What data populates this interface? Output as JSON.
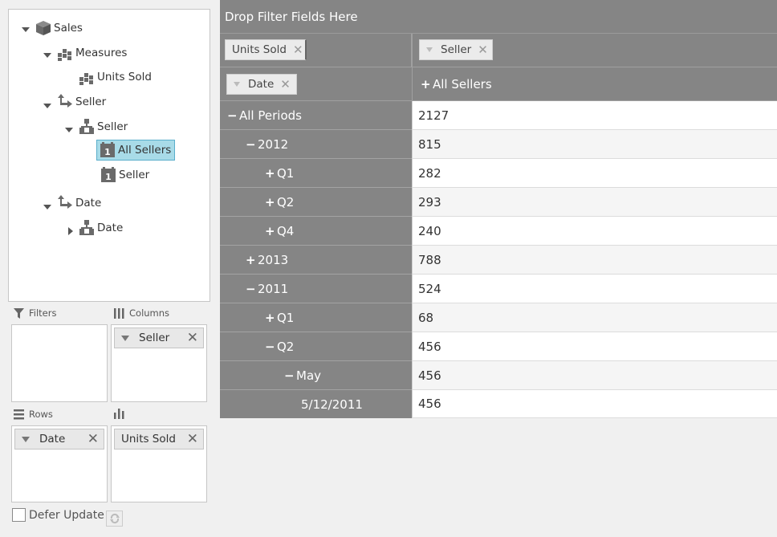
{
  "tree": {
    "root": "Sales",
    "measures": "Measures",
    "units_sold": "Units Sold",
    "seller_dim": "Seller",
    "seller_hier": "Seller",
    "all_sellers": "All Sellers",
    "seller_level": "Seller",
    "date_dim": "Date",
    "date_hier": "Date"
  },
  "areas": {
    "filters_label": "Filters",
    "columns_label": "Columns",
    "rows_label": "Rows",
    "columns_chip": "Seller",
    "rows_chip": "Date",
    "values_chip": "Units Sold"
  },
  "defer_update": "Defer Update",
  "pivot": {
    "filter_drop": "Drop Filter Fields Here",
    "data_chip": "Units Sold",
    "column_chip": "Seller",
    "row_chip": "Date",
    "column_header": "All Sellers",
    "rows": [
      {
        "sign": "−",
        "label": "All Periods",
        "value": "2127"
      },
      {
        "sign": "−",
        "label": "2012",
        "value": "815"
      },
      {
        "sign": "+",
        "label": "Q1",
        "value": "282"
      },
      {
        "sign": "+",
        "label": "Q2",
        "value": "293"
      },
      {
        "sign": "+",
        "label": "Q4",
        "value": "240"
      },
      {
        "sign": "+",
        "label": "2013",
        "value": "788"
      },
      {
        "sign": "−",
        "label": "2011",
        "value": "524"
      },
      {
        "sign": "+",
        "label": "Q1",
        "value": "68"
      },
      {
        "sign": "−",
        "label": "Q2",
        "value": "456"
      },
      {
        "sign": "−",
        "label": "May",
        "value": "456"
      },
      {
        "sign": "",
        "label": "5/12/2011",
        "value": "456"
      }
    ]
  },
  "colors": {
    "header_gray": "#858585",
    "selection": "#a8dbe8",
    "icon_gray": "#6a6a6a"
  }
}
